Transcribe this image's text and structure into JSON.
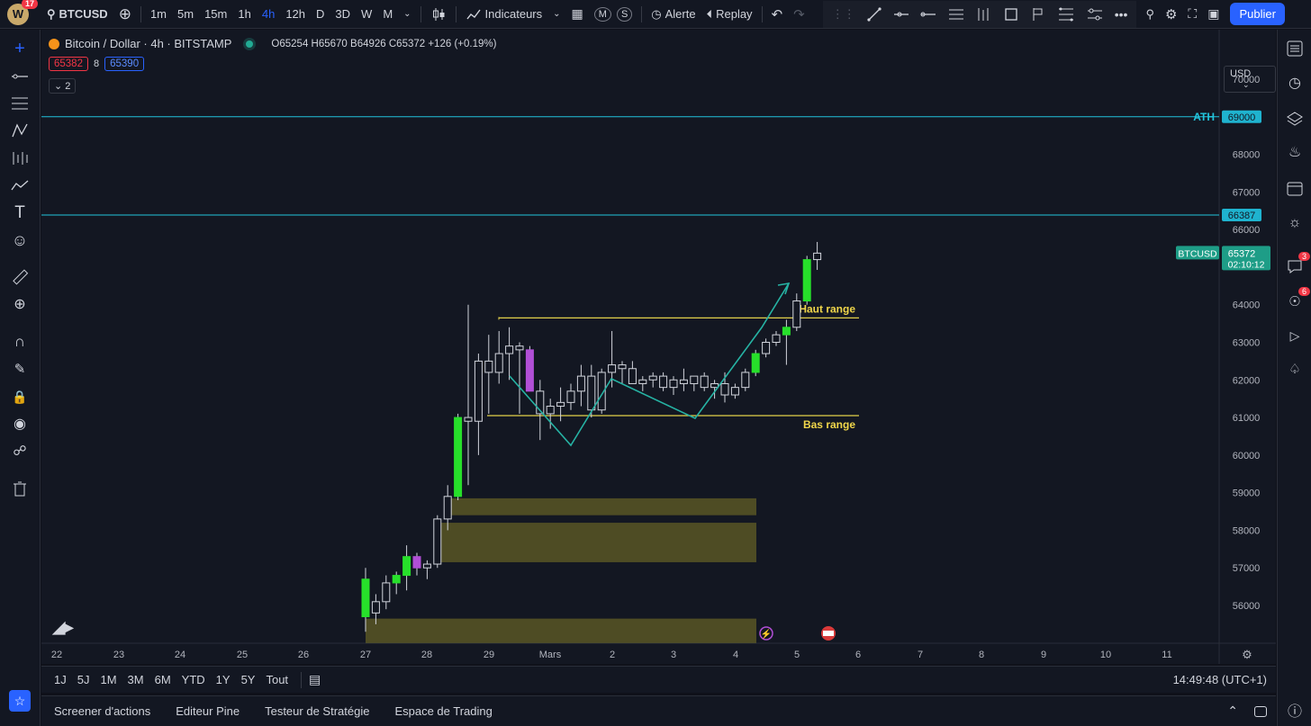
{
  "topbar": {
    "avatar_letter": "W",
    "avatar_badge": "17",
    "symbol": "BTCUSD",
    "timeframes": [
      "1m",
      "5m",
      "15m",
      "1h",
      "4h",
      "12h",
      "D",
      "3D",
      "W",
      "M"
    ],
    "active_timeframe": "4h",
    "indicators": "Indicateurs",
    "alert": "Alerte",
    "replay": "Replay",
    "publish": "Publier"
  },
  "legend": {
    "title": "Bitcoin / Dollar · 4h · BITSTAMP",
    "ohlc": "O65254  H65670  B64926  C65372  +126 (+0.19%)",
    "sell": "65382",
    "spread": "8",
    "buy": "65390",
    "indicator_count": "2",
    "currency": "USD"
  },
  "right_icons": {
    "chat_badge": "3",
    "ideas_badge": "6"
  },
  "timeframe_bar": {
    "ranges": [
      "1J",
      "5J",
      "1M",
      "3M",
      "6M",
      "YTD",
      "1Y",
      "5Y",
      "Tout"
    ],
    "clock": "14:49:48 (UTC+1)"
  },
  "bottom_tabs": [
    "Screener d'actions",
    "Editeur Pine",
    "Testeur de Stratégie",
    "Espace de Trading"
  ],
  "chart_data": {
    "type": "candlestick",
    "symbol": "BTCUSD",
    "y_ticks": [
      56000,
      57000,
      58000,
      59000,
      60000,
      61000,
      62000,
      63000,
      64000,
      65000,
      66000,
      67000,
      68000,
      69000,
      70000
    ],
    "ylim": [
      55300,
      70500
    ],
    "x_ticks": [
      "22",
      "23",
      "24",
      "25",
      "26",
      "27",
      "28",
      "29",
      "Mars",
      "2",
      "3",
      "4",
      "5",
      "6",
      "7",
      "8",
      "9",
      "10",
      "11"
    ],
    "candles": [
      {
        "o": 55700,
        "h": 57000,
        "l": 55300,
        "c": 56700,
        "col": "g"
      },
      {
        "o": 55800,
        "h": 56300,
        "l": 55500,
        "c": 56100,
        "col": "w"
      },
      {
        "o": 56100,
        "h": 56800,
        "l": 55900,
        "c": 56600,
        "col": "w"
      },
      {
        "o": 56600,
        "h": 56900,
        "l": 56300,
        "c": 56800,
        "col": "g"
      },
      {
        "o": 56800,
        "h": 57600,
        "l": 56400,
        "c": 57300,
        "col": "g"
      },
      {
        "o": 57300,
        "h": 57400,
        "l": 56800,
        "c": 57000,
        "col": "m"
      },
      {
        "o": 57000,
        "h": 57200,
        "l": 56700,
        "c": 57100,
        "col": "w"
      },
      {
        "o": 57100,
        "h": 58400,
        "l": 57000,
        "c": 58300,
        "col": "w"
      },
      {
        "o": 58300,
        "h": 59200,
        "l": 58000,
        "c": 58900,
        "col": "w"
      },
      {
        "o": 58900,
        "h": 61100,
        "l": 58800,
        "c": 61000,
        "col": "g"
      },
      {
        "o": 61000,
        "h": 64000,
        "l": 59200,
        "c": 60900,
        "col": "w"
      },
      {
        "o": 60900,
        "h": 62700,
        "l": 60000,
        "c": 62500,
        "col": "w"
      },
      {
        "o": 62500,
        "h": 63200,
        "l": 61100,
        "c": 62200,
        "col": "w"
      },
      {
        "o": 62200,
        "h": 63300,
        "l": 61900,
        "c": 62700,
        "col": "w"
      },
      {
        "o": 62700,
        "h": 63400,
        "l": 62000,
        "c": 62900,
        "col": "w"
      },
      {
        "o": 62900,
        "h": 63000,
        "l": 61100,
        "c": 62800,
        "col": "w"
      },
      {
        "o": 62800,
        "h": 62900,
        "l": 61700,
        "c": 61700,
        "col": "m"
      },
      {
        "o": 61700,
        "h": 62000,
        "l": 60400,
        "c": 61100,
        "col": "w"
      },
      {
        "o": 61100,
        "h": 61500,
        "l": 60700,
        "c": 61300,
        "col": "w"
      },
      {
        "o": 61300,
        "h": 61800,
        "l": 60900,
        "c": 61400,
        "col": "w"
      },
      {
        "o": 61400,
        "h": 61900,
        "l": 61200,
        "c": 61700,
        "col": "w"
      },
      {
        "o": 61700,
        "h": 62400,
        "l": 61300,
        "c": 62100,
        "col": "w"
      },
      {
        "o": 62100,
        "h": 62400,
        "l": 61000,
        "c": 61200,
        "col": "w"
      },
      {
        "o": 61200,
        "h": 62300,
        "l": 61100,
        "c": 62200,
        "col": "w"
      },
      {
        "o": 62200,
        "h": 63300,
        "l": 61800,
        "c": 62400,
        "col": "w"
      },
      {
        "o": 62400,
        "h": 62500,
        "l": 61900,
        "c": 62300,
        "col": "w"
      },
      {
        "o": 62300,
        "h": 62500,
        "l": 61900,
        "c": 61900,
        "col": "w"
      },
      {
        "o": 61900,
        "h": 62100,
        "l": 61700,
        "c": 62000,
        "col": "w"
      },
      {
        "o": 62000,
        "h": 62200,
        "l": 61800,
        "c": 62100,
        "col": "w"
      },
      {
        "o": 62100,
        "h": 62200,
        "l": 61700,
        "c": 61800,
        "col": "w"
      },
      {
        "o": 61800,
        "h": 62100,
        "l": 61600,
        "c": 62000,
        "col": "w"
      },
      {
        "o": 62000,
        "h": 62300,
        "l": 61700,
        "c": 61900,
        "col": "w"
      },
      {
        "o": 61900,
        "h": 62100,
        "l": 61700,
        "c": 62100,
        "col": "w"
      },
      {
        "o": 62100,
        "h": 62200,
        "l": 61700,
        "c": 61800,
        "col": "w"
      },
      {
        "o": 61800,
        "h": 62000,
        "l": 61500,
        "c": 61900,
        "col": "w"
      },
      {
        "o": 61900,
        "h": 62200,
        "l": 61400,
        "c": 61600,
        "col": "w"
      },
      {
        "o": 61600,
        "h": 61900,
        "l": 61500,
        "c": 61800,
        "col": "w"
      },
      {
        "o": 61800,
        "h": 62300,
        "l": 61700,
        "c": 62200,
        "col": "w"
      },
      {
        "o": 62200,
        "h": 62800,
        "l": 62100,
        "c": 62700,
        "col": "g"
      },
      {
        "o": 62700,
        "h": 63100,
        "l": 62600,
        "c": 63000,
        "col": "w"
      },
      {
        "o": 63000,
        "h": 63300,
        "l": 62900,
        "c": 63200,
        "col": "w"
      },
      {
        "o": 63200,
        "h": 63600,
        "l": 62400,
        "c": 63400,
        "col": "g"
      },
      {
        "o": 63400,
        "h": 64300,
        "l": 63300,
        "c": 64100,
        "col": "w"
      },
      {
        "o": 64100,
        "h": 65300,
        "l": 64000,
        "c": 65200,
        "col": "g"
      },
      {
        "o": 65200,
        "h": 65670,
        "l": 64926,
        "c": 65372,
        "col": "w"
      }
    ],
    "horizontal_levels": [
      {
        "price": 69000,
        "label": "ATH",
        "badge": "69000",
        "color": "#22c4dc"
      },
      {
        "price": 66387,
        "label": "",
        "badge": "66387",
        "color": "#22c4dc"
      }
    ],
    "current_price": {
      "symbol": "BTCUSD",
      "price": "65372",
      "countdown": "02:10:12"
    },
    "range": {
      "high": 63650,
      "low": 61050,
      "high_label": "Haut range",
      "low_label": "Bas range"
    },
    "zones": [
      {
        "top": 58850,
        "bottom": 58400
      },
      {
        "top": 58200,
        "bottom": 57150
      },
      {
        "top": 55650,
        "bottom": 55000
      }
    ]
  }
}
